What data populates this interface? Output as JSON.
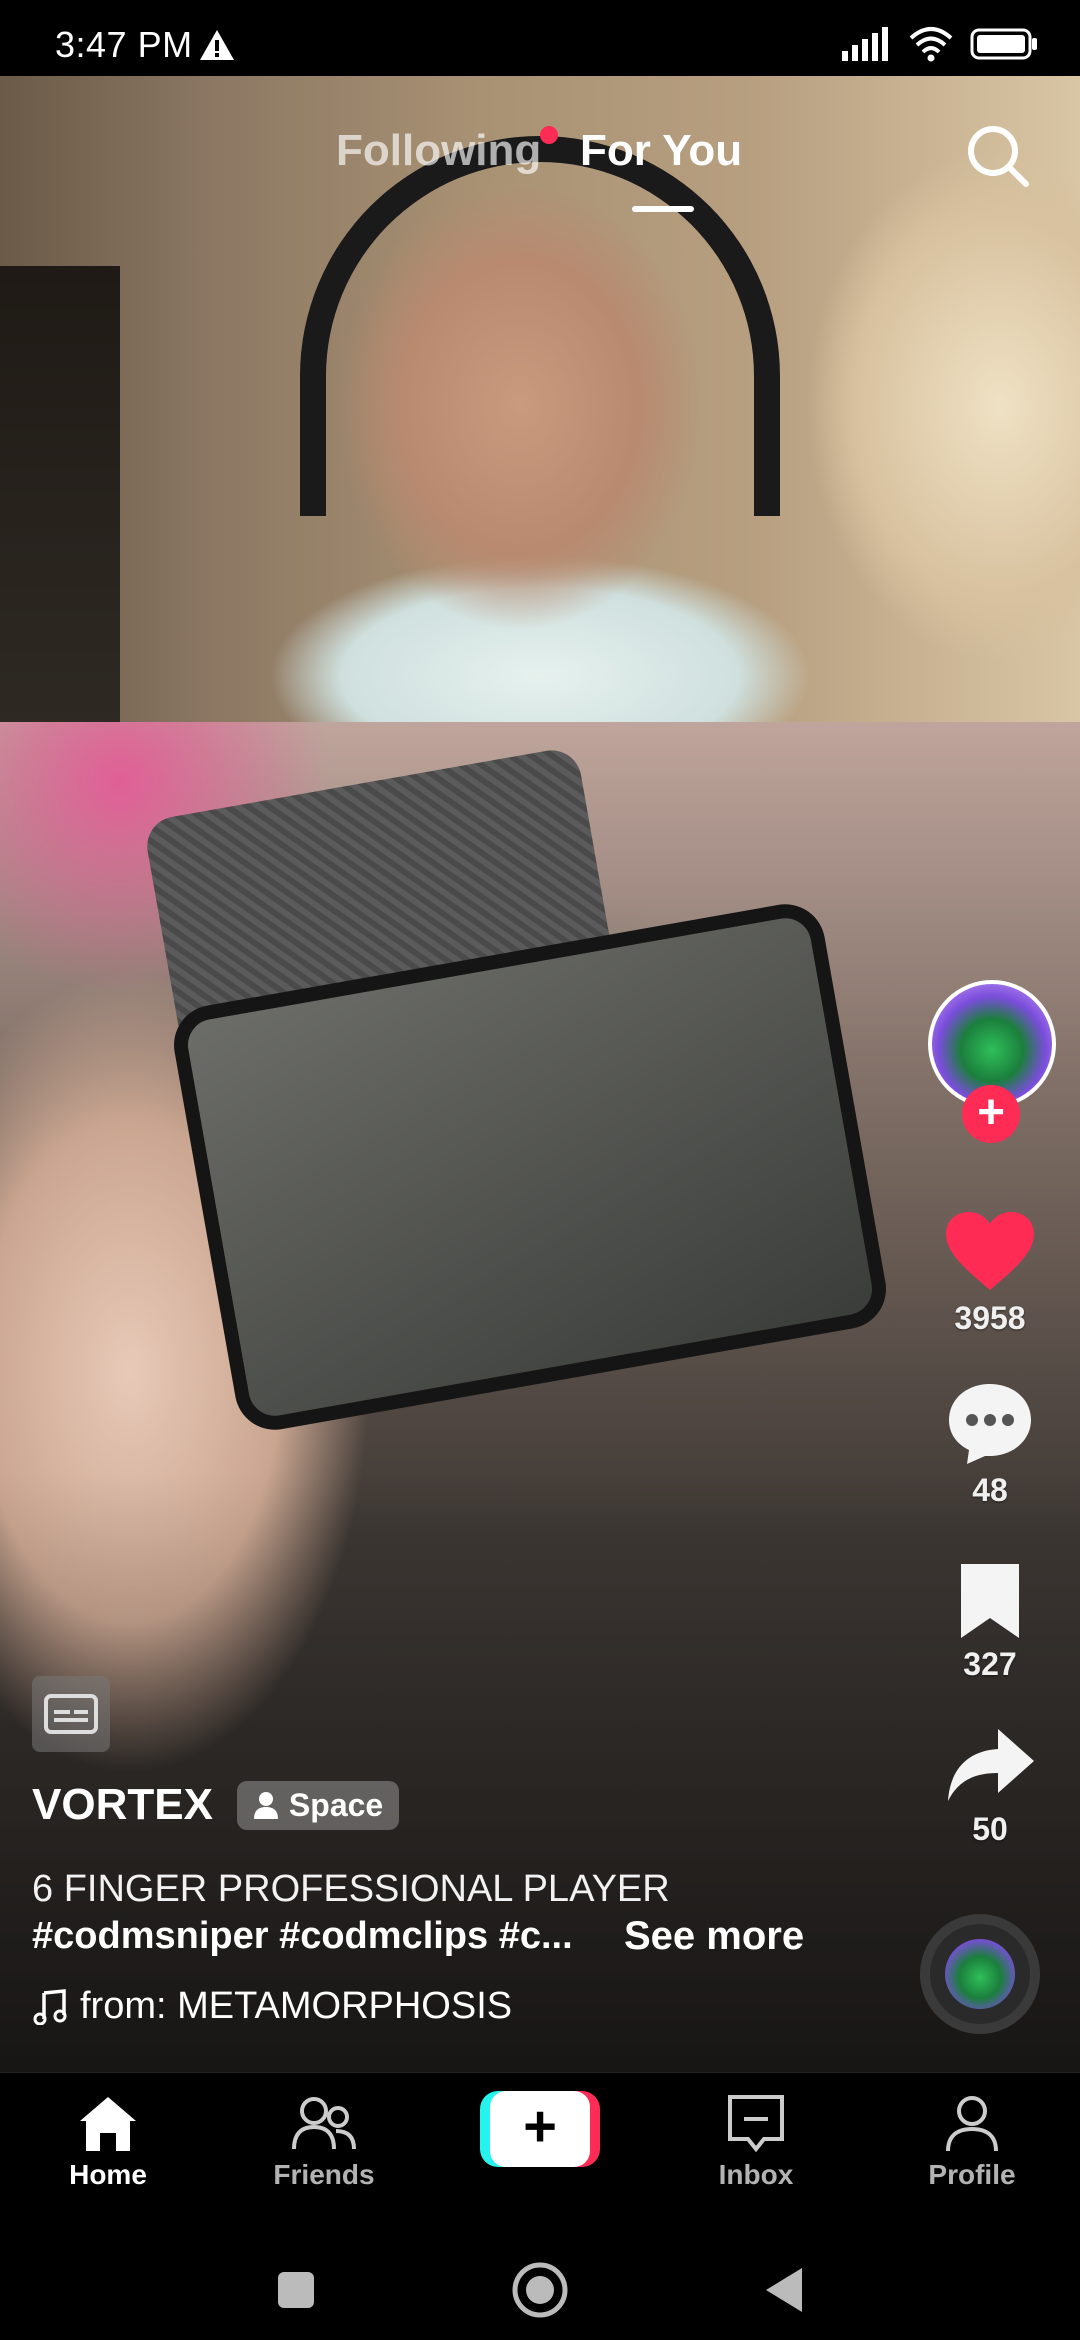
{
  "status_bar": {
    "time": "3:47 PM"
  },
  "top_tabs": {
    "following_label": "Following",
    "for_you_label": "For You",
    "active": "For You"
  },
  "post": {
    "username": "VORTEX",
    "badge_label": "Space",
    "description": "6 FINGER PROFESSIONAL PLAYER",
    "hashtags": "#codmsniper #codmclips #c...",
    "see_more_label": "See more",
    "sound": "from: METAMORPHOSIS"
  },
  "actions": {
    "likes": "3958",
    "comments": "48",
    "saves": "327",
    "shares": "50"
  },
  "bottom_nav": {
    "home_label": "Home",
    "friends_label": "Friends",
    "create_label": "+",
    "inbox_label": "Inbox",
    "profile_label": "Profile",
    "active": "Home"
  },
  "colors": {
    "accent": "#fe2c55",
    "cyan": "#25f4ee",
    "background": "#000000"
  },
  "icons": {
    "status": [
      "warning-icon",
      "signal-icon",
      "wifi-icon",
      "battery-icon"
    ],
    "rail": [
      "heart-icon",
      "comment-icon",
      "bookmark-icon",
      "share-icon"
    ]
  }
}
